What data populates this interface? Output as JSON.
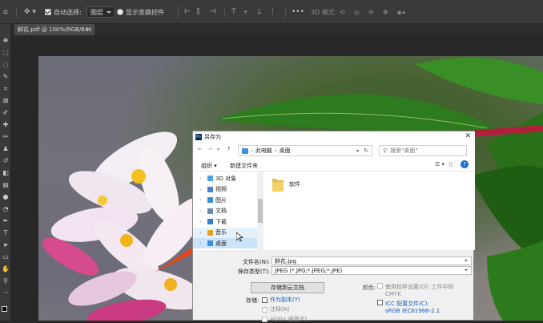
{
  "options_bar": {
    "auto_select_label": "自动选择:",
    "layer_select_value": "图层",
    "show_transform_label": "显示变换控件",
    "mode_3d_label": "3D 模式:"
  },
  "document_tab": {
    "title": "鲜花.pdf @ 100%(RGB/8#)",
    "close": "×"
  },
  "tools": [
    {
      "icon": "move-icon",
      "glyph": "✥"
    },
    {
      "icon": "marquee-icon",
      "glyph": "⬚"
    },
    {
      "icon": "lasso-icon",
      "glyph": "◌"
    },
    {
      "icon": "quick-select-icon",
      "glyph": "✎"
    },
    {
      "icon": "crop-icon",
      "glyph": "⌗"
    },
    {
      "icon": "frame-icon",
      "glyph": "⊠"
    },
    {
      "icon": "eyedropper-icon",
      "glyph": "✐"
    },
    {
      "icon": "healing-icon",
      "glyph": "✚"
    },
    {
      "icon": "brush-icon",
      "glyph": "✏"
    },
    {
      "icon": "stamp-icon",
      "glyph": "♟"
    },
    {
      "icon": "history-brush-icon",
      "glyph": "↺"
    },
    {
      "icon": "eraser-icon",
      "glyph": "◧"
    },
    {
      "icon": "gradient-icon",
      "glyph": "▤"
    },
    {
      "icon": "blur-icon",
      "glyph": "●"
    },
    {
      "icon": "dodge-icon",
      "glyph": "◔"
    },
    {
      "icon": "pen-icon",
      "glyph": "✒"
    },
    {
      "icon": "type-icon",
      "glyph": "T"
    },
    {
      "icon": "path-select-icon",
      "glyph": "➤"
    },
    {
      "icon": "shape-icon",
      "glyph": "▭"
    },
    {
      "icon": "hand-icon",
      "glyph": "✋"
    },
    {
      "icon": "zoom-icon",
      "glyph": "⚲"
    },
    {
      "icon": "more-tools-icon",
      "glyph": "···"
    }
  ],
  "dialog": {
    "title": "另存为",
    "close": "✕",
    "breadcrumb": [
      "此电脑",
      "桌面"
    ],
    "search_placeholder": "搜索\"桌面\"",
    "organize_label": "组织 ▾",
    "new_folder_label": "新建文件夹",
    "nav_items": [
      {
        "label": "3D 对象",
        "icon_color": "#4aa3df"
      },
      {
        "label": "视频",
        "icon_color": "#4a7fd1"
      },
      {
        "label": "图片",
        "icon_color": "#3d8fd6"
      },
      {
        "label": "文档",
        "icon_color": "#6a8ab0"
      },
      {
        "label": "下载",
        "icon_color": "#2f7fd1"
      },
      {
        "label": "音乐",
        "icon_color": "#e0a020"
      },
      {
        "label": "桌面",
        "icon_color": "#3b8ee0"
      }
    ],
    "folder_name": "软件",
    "filename_label": "文件名(N):",
    "filename_value": "鲜花.jpg",
    "filetype_label": "保存类型(T):",
    "filetype_value": "JPEG (*.JPG;*.JPEG;*.JPE)",
    "cloud_button": "存储到云文档",
    "save_label": "存储:",
    "as_copy_label": "作为副本(Y)",
    "notes_label": "注释(N)",
    "alpha_label": "Alpha 通道(E)",
    "color_label": "颜色:",
    "proof_label": "使用校样设置(O): 工作中的 CMYK",
    "icc_label": "ICC 配置文件(C):",
    "icc_value": "sRGB IEC61966-2.1"
  },
  "colors": {
    "accent_link": "#1a5fb4",
    "selected_row": "#cce4f7",
    "hover_row": "#e5f1fb"
  }
}
